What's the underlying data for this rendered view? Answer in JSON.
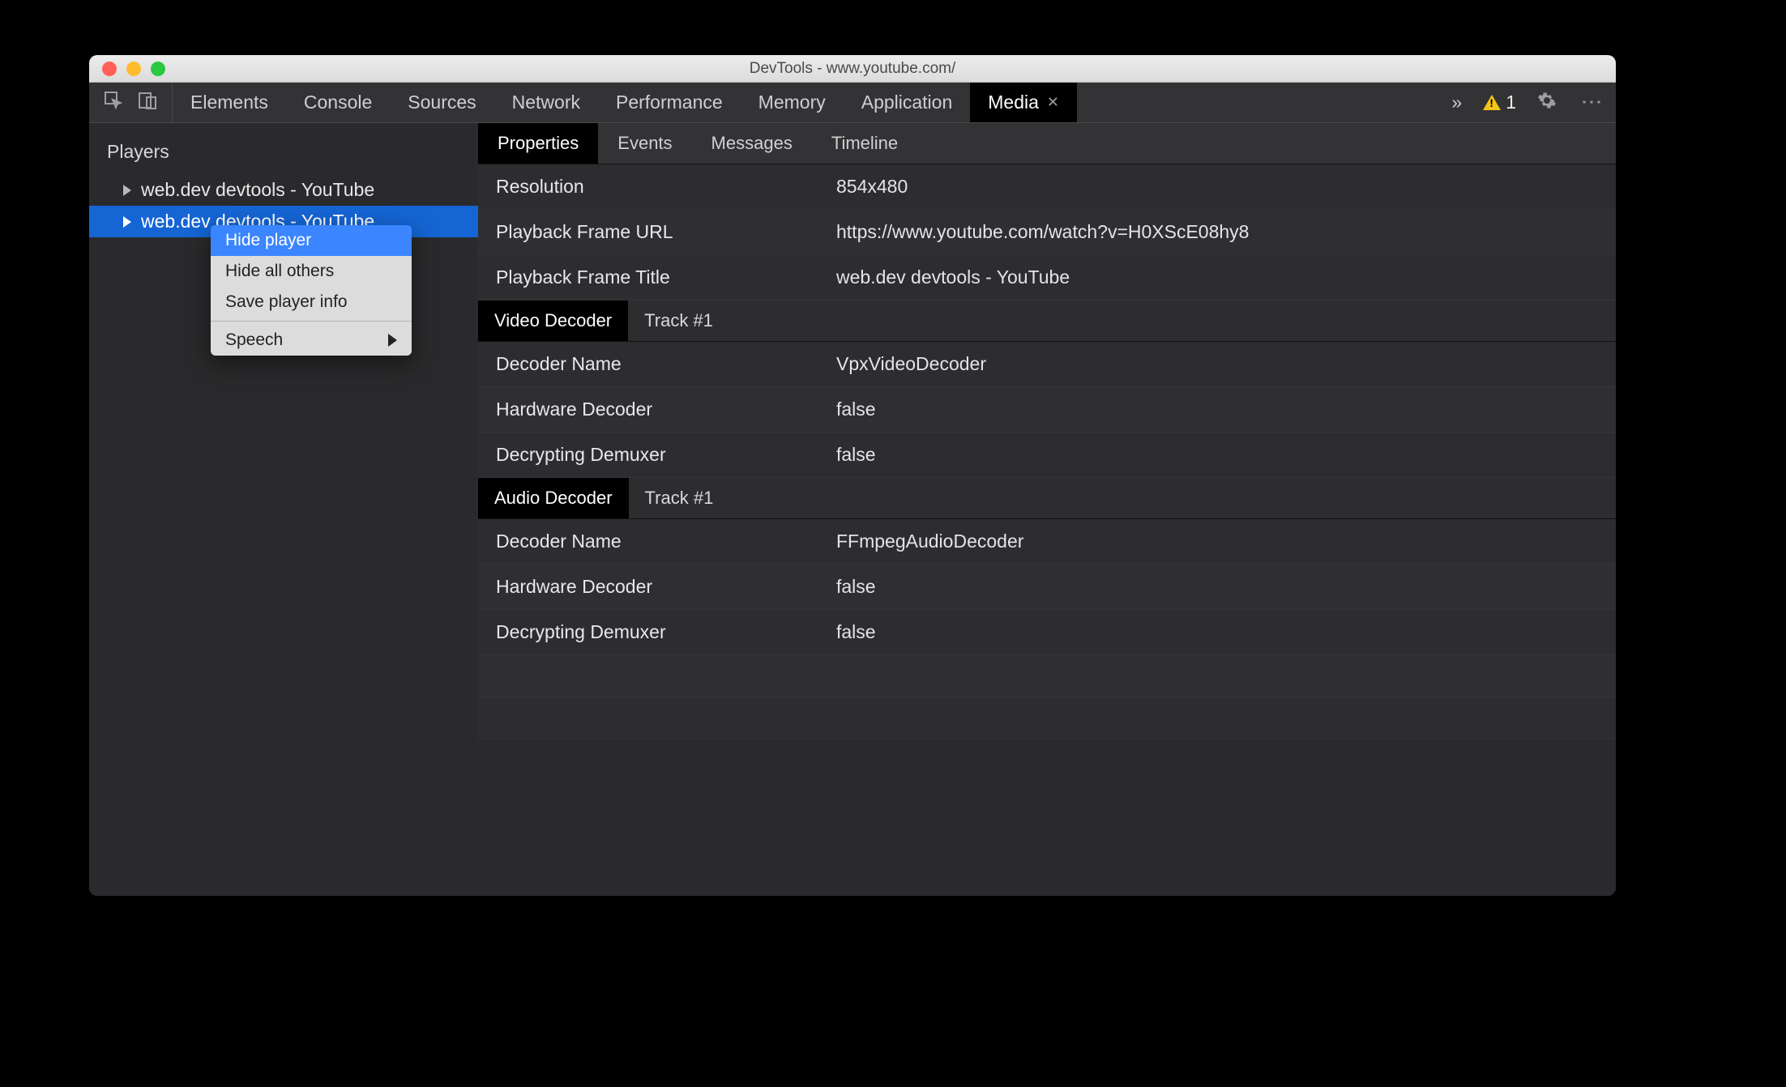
{
  "titlebar": {
    "title": "DevTools - www.youtube.com/"
  },
  "toolbar": {
    "tabs": [
      "Elements",
      "Console",
      "Sources",
      "Network",
      "Performance",
      "Memory",
      "Application",
      "Media"
    ],
    "active_tab": "Media",
    "overflow_glyph": "»",
    "warning_count": "1"
  },
  "sidebar": {
    "title": "Players",
    "players": [
      {
        "label": "web.dev devtools - YouTube",
        "selected": false
      },
      {
        "label": "web.dev devtools - YouTube",
        "selected": true
      }
    ]
  },
  "context_menu": {
    "items": [
      {
        "label": "Hide player",
        "highlighted": true
      },
      {
        "label": "Hide all others"
      },
      {
        "label": "Save player info"
      }
    ],
    "submenu_label": "Speech"
  },
  "subtabs": {
    "items": [
      "Properties",
      "Events",
      "Messages",
      "Timeline"
    ],
    "active": "Properties"
  },
  "properties": {
    "general": [
      {
        "k": "Resolution",
        "v": "854x480"
      },
      {
        "k": "Playback Frame URL",
        "v": "https://www.youtube.com/watch?v=H0XScE08hy8"
      },
      {
        "k": "Playback Frame Title",
        "v": "web.dev devtools - YouTube"
      }
    ],
    "video_section": {
      "chip": "Video Decoder",
      "sub": "Track #1"
    },
    "video": [
      {
        "k": "Decoder Name",
        "v": "VpxVideoDecoder"
      },
      {
        "k": "Hardware Decoder",
        "v": "false"
      },
      {
        "k": "Decrypting Demuxer",
        "v": "false"
      }
    ],
    "audio_section": {
      "chip": "Audio Decoder",
      "sub": "Track #1"
    },
    "audio": [
      {
        "k": "Decoder Name",
        "v": "FFmpegAudioDecoder"
      },
      {
        "k": "Hardware Decoder",
        "v": "false"
      },
      {
        "k": "Decrypting Demuxer",
        "v": "false"
      }
    ]
  }
}
